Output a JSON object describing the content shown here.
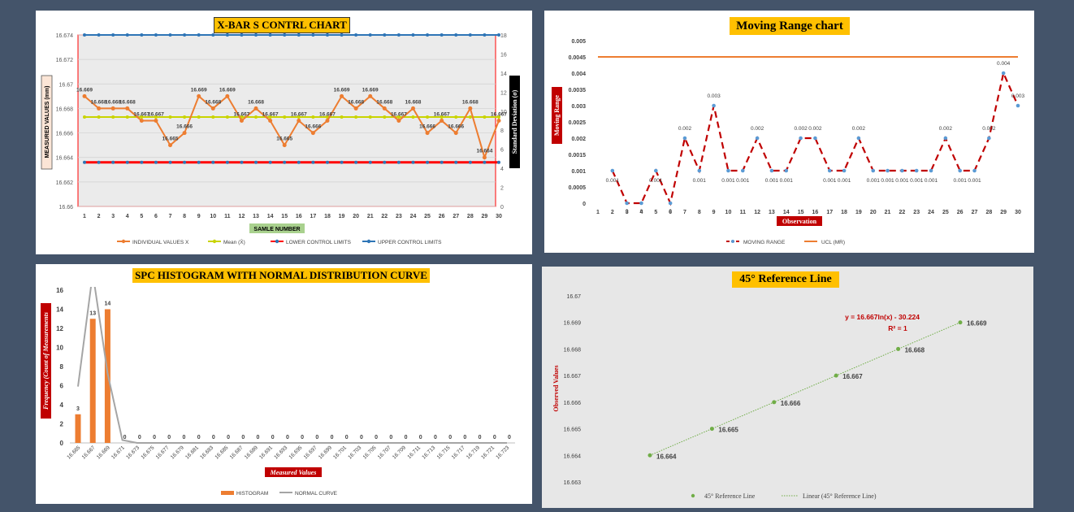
{
  "colors": {
    "background": "#44546a",
    "orange": "#ed7d31",
    "yellow": "#c9d400",
    "red": "#ff0000",
    "blue": "#2e75b6",
    "moving_range_red": "#c00000",
    "mr_points": "#5b9bd5",
    "gray_curve": "#a5a5a5",
    "green_points": "#70ad47",
    "title_bg": "#ffc000",
    "axis_title_bg": "#c00000"
  },
  "chart_data": [
    {
      "id": "xbar",
      "type": "line",
      "title": "X-BAR S CONTRL CHART",
      "xlabel": "SAMLE NUMBER",
      "ylabel": "MEASURED VALUES (mm)",
      "y2label": "Standard Deviation (σ)",
      "x": [
        1,
        2,
        3,
        4,
        5,
        6,
        7,
        8,
        9,
        10,
        11,
        12,
        13,
        14,
        15,
        16,
        17,
        18,
        19,
        20,
        21,
        22,
        23,
        24,
        25,
        26,
        27,
        28,
        29,
        30
      ],
      "ylim": [
        16.66,
        16.674
      ],
      "yticks": [
        "16.66",
        "16.662",
        "16.664",
        "16.666",
        "16.668",
        "16.67",
        "16.672",
        "16.674"
      ],
      "y2lim": [
        0,
        18
      ],
      "y2ticks": [
        "0",
        "2",
        "4",
        "6",
        "8",
        "10",
        "12",
        "14",
        "16",
        "18"
      ],
      "grid": true,
      "legend": "bottom",
      "series": [
        {
          "name": "INDIVIDUAL VALUES X",
          "values": [
            16.669,
            16.668,
            16.668,
            16.668,
            16.667,
            16.667,
            16.665,
            16.666,
            16.669,
            16.668,
            16.669,
            16.667,
            16.668,
            16.667,
            16.665,
            16.667,
            16.666,
            16.667,
            16.669,
            16.668,
            16.669,
            16.668,
            16.667,
            16.668,
            16.666,
            16.667,
            16.666,
            16.668,
            16.664,
            16.667
          ],
          "labels": [
            "16.669",
            "16.668",
            "16.668",
            "16.668",
            "16.667",
            "16.667",
            "16.665",
            "16.666",
            "16.669",
            "16.668",
            "16.669",
            "16.667",
            "16.668",
            "16.667",
            "16.665",
            "16.667",
            "16.666",
            "16.667",
            "16.669",
            "16.668",
            "16.669",
            "16.668",
            "16.667",
            "16.668",
            "16.666",
            "16.667",
            "16.666",
            "16.668",
            "16.664",
            "16.667"
          ]
        },
        {
          "name": "Mean (X̄)",
          "values_constant": 16.6673
        },
        {
          "name": "LOWER CONTROL LIMITS",
          "values_constant": 16.6636
        },
        {
          "name": "UPPER CONTROL LIMITS",
          "values_constant": 16.674
        }
      ]
    },
    {
      "id": "mr",
      "type": "line",
      "title": "Moving Range chart",
      "xlabel": "Observation",
      "ylabel": "Moving Range",
      "x": [
        1,
        2,
        3,
        4,
        5,
        6,
        7,
        8,
        9,
        10,
        11,
        12,
        13,
        14,
        15,
        16,
        17,
        18,
        19,
        20,
        21,
        22,
        23,
        24,
        25,
        26,
        27,
        28,
        29,
        30
      ],
      "ylim": [
        0,
        0.005
      ],
      "yticks": [
        "0",
        "0.0005",
        "0.001",
        "0.0015",
        "0.002",
        "0.0025",
        "0.003",
        "0.0035",
        "0.004",
        "0.0045",
        "0.005"
      ],
      "legend": "bottom",
      "series": [
        {
          "name": "MOVING RANGE",
          "values": [
            null,
            0.001,
            0,
            0,
            0.001,
            0,
            0.002,
            0.001,
            0.003,
            0.001,
            0.001,
            0.002,
            0.001,
            0.001,
            0.002,
            0.002,
            0.001,
            0.001,
            0.002,
            0.001,
            0.001,
            0.001,
            0.001,
            0.001,
            0.002,
            0.001,
            0.001,
            0.002,
            0.004,
            0.003
          ],
          "labels": [
            null,
            "0.001",
            "0",
            "0",
            "0.001",
            "0",
            "0.002",
            "0.001",
            "0.003",
            "0.001",
            "0.001",
            "0.002",
            "0.001",
            "0.001",
            "0.002",
            "0.002",
            "0.001",
            "0.001",
            "0.002",
            "0.001",
            "0.001",
            "0.001",
            "0.001",
            "0.001",
            "0.002",
            "0.001",
            "0.001",
            "0.002",
            "0.004",
            "0.003"
          ]
        },
        {
          "name": "UCL (MR)",
          "values_constant": 0.0045
        }
      ]
    },
    {
      "id": "hist",
      "type": "bar",
      "title": "SPC HISTOGRAM WITH NORMAL DISTRIBUTION CURVE",
      "xlabel": "Measured Values",
      "ylabel": "Frequency (Count of Measurements",
      "categories": [
        "16.665",
        "16.667",
        "16.669",
        "16.671",
        "16.673",
        "16.675",
        "16.677",
        "16.679",
        "16.681",
        "16.683",
        "16.685",
        "16.687",
        "16.689",
        "16.691",
        "16.693",
        "16.695",
        "16.697",
        "16.699",
        "16.701",
        "16.703",
        "16.705",
        "16.707",
        "16.709",
        "16.711",
        "16.713",
        "16.715",
        "16.717",
        "16.719",
        "16.721",
        "16.723"
      ],
      "values": [
        3,
        13,
        14,
        0,
        0,
        0,
        0,
        0,
        0,
        0,
        0,
        0,
        0,
        0,
        0,
        0,
        0,
        0,
        0,
        0,
        0,
        0,
        0,
        0,
        0,
        0,
        0,
        0,
        0,
        0
      ],
      "labels": [
        "3",
        "13",
        "14",
        "0",
        "0",
        "0",
        "0",
        "0",
        "0",
        "0",
        "0",
        "0",
        "0",
        "0",
        "0",
        "0",
        "0",
        "0",
        "0",
        "0",
        "0",
        "0",
        "0",
        "0",
        "0",
        "0",
        "0",
        "0",
        "0",
        "0"
      ],
      "curve": [
        5.9,
        17.8,
        7.3,
        0.3,
        0,
        0,
        0,
        0,
        0,
        0,
        0,
        0,
        0,
        0,
        0,
        0,
        0,
        0,
        0,
        0,
        0,
        0,
        0,
        0,
        0,
        0,
        0,
        0,
        0,
        0
      ],
      "ylim": [
        0,
        16
      ],
      "yticks": [
        "0",
        "2",
        "4",
        "6",
        "8",
        "10",
        "12",
        "14",
        "16"
      ],
      "legend": "bottom",
      "series": [
        {
          "name": "HISTOGRAM"
        },
        {
          "name": "NORMAL CURVE"
        }
      ]
    },
    {
      "id": "ref45",
      "type": "scatter",
      "title": "45° Reference Line",
      "ylabel": "Observed Values",
      "x": [
        16.664,
        16.665,
        16.666,
        16.667,
        16.668,
        16.669
      ],
      "y": [
        16.664,
        16.665,
        16.666,
        16.667,
        16.668,
        16.669
      ],
      "labels": [
        "16.664",
        "16.665",
        "16.666",
        "16.667",
        "16.668",
        "16.669"
      ],
      "ylim": [
        16.663,
        16.67
      ],
      "yticks": [
        "16.663",
        "16.664",
        "16.665",
        "16.666",
        "16.667",
        "16.668",
        "16.669",
        "16.67"
      ],
      "equation": "y = 16.667ln(x) - 30.224",
      "r2": "R² = 1",
      "legend": "bottom",
      "series": [
        {
          "name": "45° Reference Line"
        },
        {
          "name": "Linear (45° Reference Line)"
        }
      ]
    }
  ]
}
